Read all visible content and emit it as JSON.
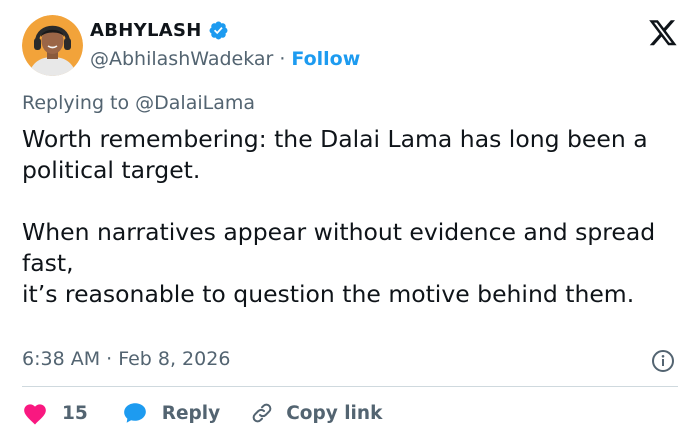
{
  "author": {
    "display_name": "ABHYLASH",
    "handle": "@AbhilashWadekar",
    "separator": "·",
    "follow_label": "Follow"
  },
  "reply_context": {
    "text": "Replying to @DalaiLama"
  },
  "tweet": {
    "paragraph_1": "Worth remembering: the Dalai Lama has long been a political target.",
    "paragraph_2_line_1": "When narratives appear without evidence and spread fast,",
    "paragraph_2_line_2": "it’s reasonable to question the motive behind them."
  },
  "meta": {
    "timestamp": "6:38 AM · Feb 8, 2026"
  },
  "actions": {
    "like_count": "15",
    "reply_label": "Reply",
    "copy_link_label": "Copy link"
  },
  "colors": {
    "accent": "#1d9bf0",
    "like_pink": "#f91880",
    "secondary_text": "#536471",
    "primary_text": "#0f1419",
    "divider": "#cfd9de"
  },
  "icons": [
    "verified-badge-icon",
    "x-logo-icon",
    "info-icon",
    "heart-icon",
    "reply-bubble-icon",
    "link-icon"
  ]
}
